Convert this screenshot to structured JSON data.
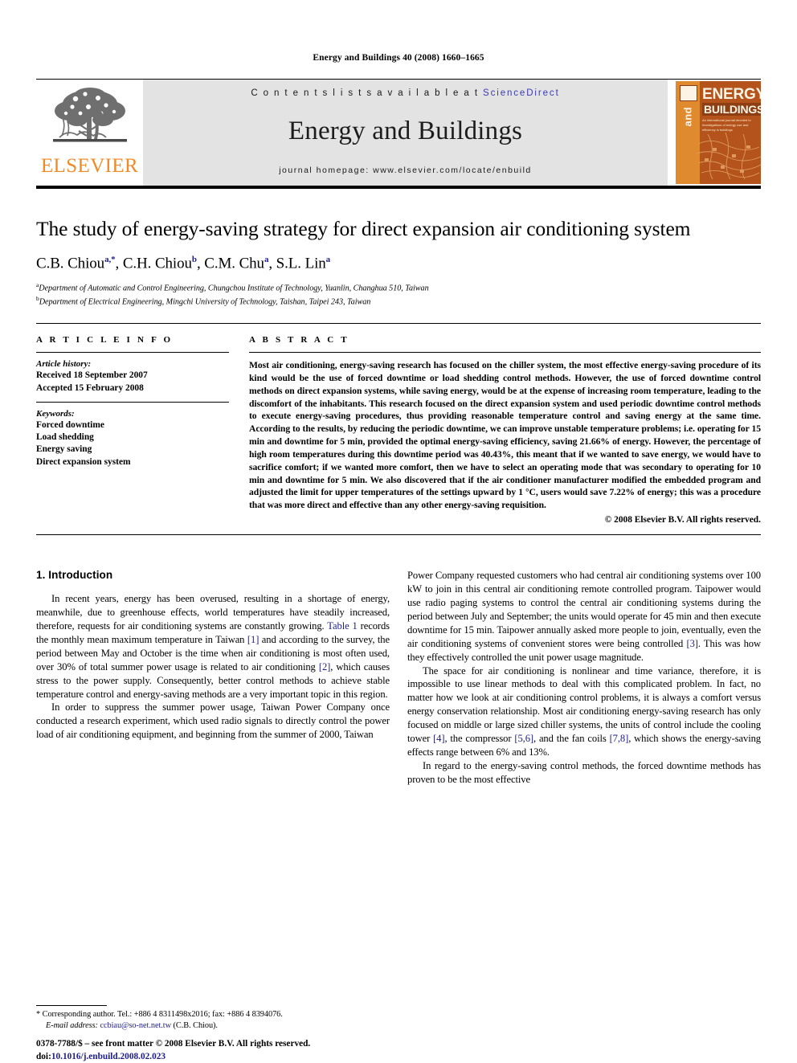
{
  "running_head": "Energy and Buildings 40 (2008) 1660–1665",
  "masthead": {
    "publisher_name": "ELSEVIER",
    "contents_prefix": "C o n t e n t s   l i s t s   a v a i l a b l e   a t ",
    "contents_link": "ScienceDirect",
    "journal_title": "Energy and Buildings",
    "homepage": "journal homepage: www.elsevier.com/locate/enbuild",
    "cover": {
      "line_and": "and",
      "line_energy": "ENERGY",
      "line_buildings": "BUILDINGS",
      "line_sub": "An international journal devoted to investigations of energy use and efficiency in buildings"
    }
  },
  "article": {
    "title": "The study of energy-saving strategy for direct expansion air conditioning system",
    "authors_html": "C.B. Chiou<sup>a,*</sup>, C.H. Chiou<sup>b</sup>, C.M. Chu<sup>a</sup>, S.L. Lin<sup>a</sup>",
    "affiliation_a": "Department of Automatic and Control Engineering, Chungchou Institute of Technology, Yuanlin, Changhua 510, Taiwan",
    "affiliation_b": "Department of Electrical Engineering, Mingchi University of Technology, Taishan, Taipei 243, Taiwan",
    "affiliation_a_marker": "a",
    "affiliation_b_marker": "b"
  },
  "article_info": {
    "heading": "A R T I C L E   I N F O",
    "history_title": "Article history:",
    "received": "Received 18 September 2007",
    "accepted": "Accepted 15 February 2008",
    "keywords_title": "Keywords:",
    "keywords": [
      "Forced downtime",
      "Load shedding",
      "Energy saving",
      "Direct expansion system"
    ]
  },
  "abstract": {
    "heading": "A B S T R A C T",
    "text": "Most air conditioning, energy-saving research has focused on the chiller system, the most effective energy-saving procedure of its kind would be the use of forced downtime or load shedding control methods. However, the use of forced downtime control methods on direct expansion systems, while saving energy, would be at the expense of increasing room temperature, leading to the discomfort of the inhabitants. This research focused on the direct expansion system and used periodic downtime control methods to execute energy-saving procedures, thus providing reasonable temperature control and saving energy at the same time. According to the results, by reducing the periodic downtime, we can improve unstable temperature problems; i.e. operating for 15 min and downtime for 5 min, provided the optimal energy-saving efficiency, saving 21.66% of energy. However, the percentage of high room temperatures during this downtime period was 40.43%, this meant that if we wanted to save energy, we would have to sacrifice comfort; if we wanted more comfort, then we have to select an operating mode that was secondary to operating for 10 min and downtime for 5 min. We also discovered that if the air conditioner manufacturer modified the embedded program and adjusted the limit for upper temperatures of the settings upward by 1 °C, users would save 7.22% of energy; this was a procedure that was more direct and effective than any other energy-saving requisition.",
    "copyright": "© 2008 Elsevier B.V. All rights reserved."
  },
  "body": {
    "section_heading": "1. Introduction",
    "left_paragraphs": [
      "In recent years, energy has been overused, resulting in a shortage of energy, meanwhile, due to greenhouse effects, world temperatures have steadily increased, therefore, requests for air conditioning systems are constantly growing. Table 1 records the monthly mean maximum temperature in Taiwan [1] and according to the survey, the period between May and October is the time when air conditioning is most often used, over 30% of total summer power usage is related to air conditioning [2], which causes stress to the power supply. Consequently, better control methods to achieve stable temperature control and energy-saving methods are a very important topic in this region.",
      "In order to suppress the summer power usage, Taiwan Power Company once conducted a research experiment, which used radio signals to directly control the power load of air conditioning equipment, and beginning from the summer of 2000, Taiwan"
    ],
    "right_paragraphs": [
      "Power Company requested customers who had central air conditioning systems over 100 kW to join in this central air conditioning remote controlled program. Taipower would use radio paging systems to control the central air conditioning systems during the period between July and September; the units would operate for 45 min and then execute downtime for 15 min. Taipower annually asked more people to join, eventually, even the air conditioning systems of convenient stores were being controlled [3]. This was how they effectively controlled the unit power usage magnitude.",
      "The space for air conditioning is nonlinear and time variance, therefore, it is impossible to use linear methods to deal with this complicated problem. In fact, no matter how we look at air conditioning control problems, it is always a comfort versus energy conservation relationship. Most air conditioning energy-saving research has only focused on middle or large sized chiller systems, the units of control include the cooling tower [4], the compressor [5,6], and the fan coils [7,8], which shows the energy-saving effects range between 6% and 13%.",
      "In regard to the energy-saving control methods, the forced downtime methods has proven to be the most effective"
    ]
  },
  "footer": {
    "corresponding_marker": "*",
    "corresponding_text": "Corresponding author. Tel.: +886 4 8311498x2016; fax: +886 4 8394076.",
    "email_label": "E-mail address:",
    "email": "ccbiau@so-net.net.tw",
    "email_owner": "(C.B. Chiou).",
    "issn_line": "0378-7788/$ – see front matter © 2008 Elsevier B.V. All rights reserved.",
    "doi_label": "doi:",
    "doi": "10.1016/j.enbuild.2008.02.023"
  },
  "colors": {
    "elsevier_orange": "#f08a24",
    "link_blue": "#1d1d8c",
    "sciencedirect_blue": "#3a3ab4",
    "band_gray": "#e3e3e3",
    "cover_brown": "#b4541c",
    "cover_orange": "#e08a30"
  }
}
